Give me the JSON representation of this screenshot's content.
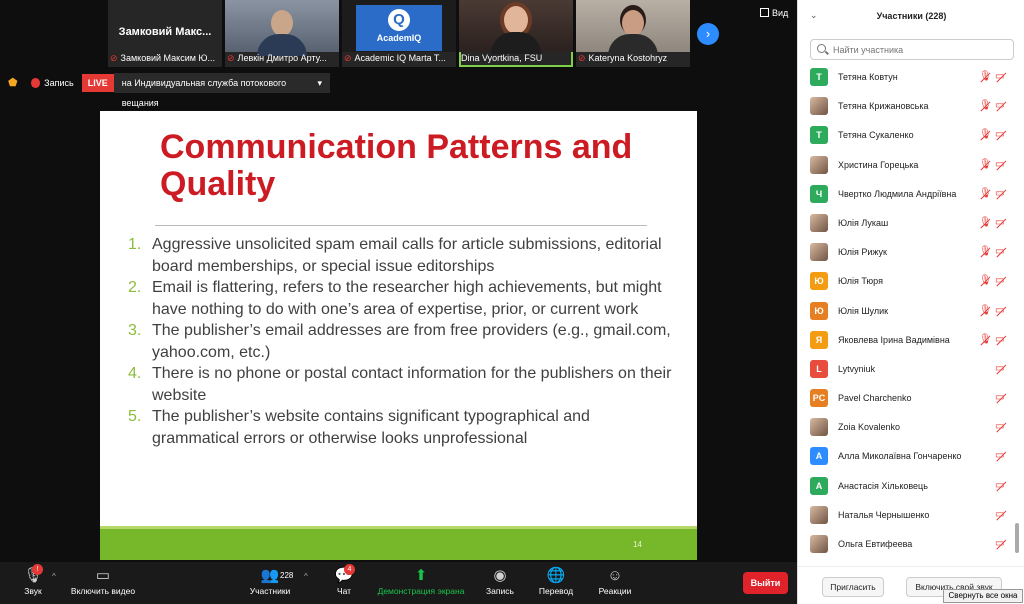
{
  "thumbnails": [
    {
      "big_name": "Замковий  Макс...",
      "label": "Замковий Максим Ю...",
      "kind": "name"
    },
    {
      "label": "Левкін Дмитро Арту...",
      "kind": "video1"
    },
    {
      "label": "Academic IQ Marta T...",
      "kind": "logo",
      "logo_text": "AcademIQ"
    },
    {
      "label": "Dina Vyortkina, FSU",
      "kind": "video3",
      "speaking": true
    },
    {
      "label": "Kateryna Kostohryz",
      "kind": "video4"
    }
  ],
  "view_label": "Вид",
  "status": {
    "record_label": "Запись",
    "live_label": "LIVE",
    "stream_label": "на Индивидуальная служба потокового вещания",
    "stream_caret": "▾"
  },
  "slide": {
    "title": "Communication Patterns and Quality",
    "items": [
      {
        "num": "1.",
        "text": "Aggressive unsolicited spam email calls for article submissions, editorial board memberships, or special issue editorships"
      },
      {
        "num": "2.",
        "text": "Email is flattering, refers to the researcher high achievements, but might have nothing to do with one’s area of expertise, prior, or current work"
      },
      {
        "num": "3.",
        "text": "The publisher’s email addresses are from free providers (e.g., gmail.com, yahoo.com, etc.)"
      },
      {
        "num": "4.",
        "text": "There is no phone or postal contact information for the publishers on their website"
      },
      {
        "num": "5.",
        "text": "The publisher’s website contains significant typographical and grammatical errors or otherwise looks unprofessional"
      }
    ],
    "page_number": "14"
  },
  "toolbar": {
    "audio": {
      "label": "Звук",
      "badge": "!"
    },
    "video": {
      "label": "Включить видео"
    },
    "participants": {
      "label": "Участники",
      "count": "228"
    },
    "chat": {
      "label": "Чат",
      "badge": "4"
    },
    "share": {
      "label": "Демонстрация экрана"
    },
    "record": {
      "label": "Запись"
    },
    "translate": {
      "label": "Перевод"
    },
    "reactions": {
      "label": "Реакции"
    },
    "leave": "Выйти"
  },
  "panel": {
    "title": "Участники (228)",
    "search_placeholder": "Найти участника",
    "participants": [
      {
        "name": "Тетяна Ковтун",
        "initial": "Т",
        "color": "#2eaa5c",
        "mic_muted": true
      },
      {
        "name": "Тетяна Крижановська",
        "initial": "",
        "color": "",
        "photo": true,
        "mic_muted": true
      },
      {
        "name": "Тетяна Сукаленко",
        "initial": "Т",
        "color": "#2eaa5c",
        "mic_muted": true
      },
      {
        "name": "Христина Горецька",
        "initial": "",
        "color": "",
        "photo": true,
        "mic_muted": true
      },
      {
        "name": "Чвертко Людмила Андріївна",
        "initial": "Ч",
        "color": "#2eaa5c",
        "mic_muted": true
      },
      {
        "name": "Юлія Лукаш",
        "initial": "",
        "color": "",
        "photo": true,
        "mic_muted": true
      },
      {
        "name": "Юлія Рижук",
        "initial": "",
        "color": "",
        "photo": true,
        "mic_muted": true
      },
      {
        "name": "Юлія Тюря",
        "initial": "Ю",
        "color": "#f39c12",
        "mic_muted": true
      },
      {
        "name": "Юлія Шулик",
        "initial": "Ю",
        "color": "#e67e22",
        "mic_muted": true
      },
      {
        "name": "Яковлева Ірина Вадимівна",
        "initial": "Я",
        "color": "#f39c12",
        "mic_muted": true
      },
      {
        "name": "Lytvyniuk",
        "initial": "L",
        "color": "#e74c3c",
        "mic_muted": false
      },
      {
        "name": "Pavel Charchenko",
        "initial": "PC",
        "color": "#e67e22",
        "mic_muted": false
      },
      {
        "name": "Zoia Kovalenko",
        "initial": "",
        "color": "",
        "photo": true,
        "mic_muted": false
      },
      {
        "name": "Алла Миколаївна Гончаренко",
        "initial": "А",
        "color": "#2d8cff",
        "mic_muted": false
      },
      {
        "name": "Анастасія Хільковець",
        "initial": "А",
        "color": "#2eaa5c",
        "mic_muted": false
      },
      {
        "name": "Наталья Чернышенко",
        "initial": "",
        "color": "",
        "photo": true,
        "mic_muted": false
      },
      {
        "name": "Ольга Евтифеева",
        "initial": "",
        "color": "",
        "photo": true,
        "mic_muted": false
      }
    ],
    "invite_label": "Пригласить",
    "unmute_label": "Включить свой звук",
    "tooltip": "Свернуть все окна"
  }
}
